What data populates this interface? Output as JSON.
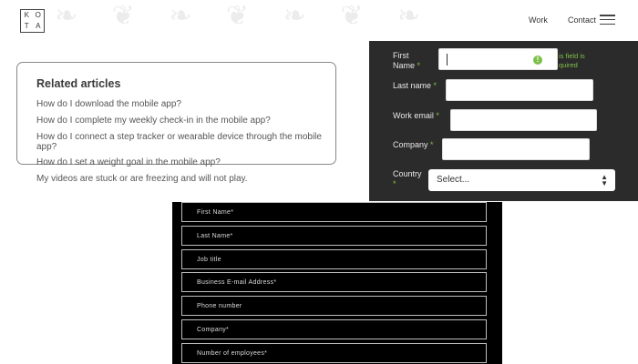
{
  "header": {
    "logo_letters": [
      "K",
      "O",
      "T",
      "A"
    ],
    "nav": {
      "work": "Work",
      "contact": "Contact"
    }
  },
  "related": {
    "title": "Related articles",
    "articles": [
      "How do I download the mobile app?",
      "How do I complete my weekly check-in in the mobile app?",
      "How do I connect a step tracker or wearable device through the mobile app?",
      "How do I set a weight goal in the mobile app?",
      "My videos are stuck or are freezing and will not play."
    ]
  },
  "dark_form": {
    "fields": [
      {
        "label": "First Name",
        "required": "*"
      },
      {
        "label": "Last name",
        "required": "*"
      },
      {
        "label": "Work email",
        "required": "*"
      },
      {
        "label": "Company",
        "required": "*"
      },
      {
        "label": "Country",
        "required": "*"
      }
    ],
    "warn_icon": "!",
    "error_text": "is field is quired",
    "country_select": {
      "value": "Select..."
    },
    "accent": "#7cc04a"
  },
  "black_form": {
    "fields": [
      "First Name*",
      "Last Name*",
      "Job title",
      "Business E-mail Address*",
      "Phone number",
      "Company*",
      "Number of employees*"
    ]
  }
}
